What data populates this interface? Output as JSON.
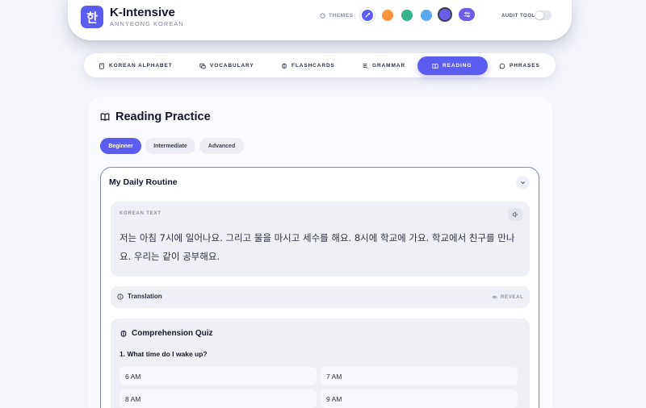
{
  "header": {
    "logo_glyph": "한",
    "title": "K-Intensive",
    "subtitle": "ANNYEONG KOREAN",
    "themes_label": "THEMES",
    "theme_colors": [
      "#5b5cf0",
      "#fb923c",
      "#34b38a",
      "#5aa9f0",
      "#6d5ce6"
    ],
    "audit_label": "AUDIT TOOL"
  },
  "nav": {
    "items": [
      {
        "label": "KOREAN ALPHABET",
        "icon": "book-icon"
      },
      {
        "label": "VOCABULARY",
        "icon": "chat-icon"
      },
      {
        "label": "FLASHCARDS",
        "icon": "brain-icon"
      },
      {
        "label": "GRAMMAR",
        "icon": "notes-icon"
      },
      {
        "label": "READING",
        "icon": "open-book-icon",
        "active": true
      },
      {
        "label": "PHRASES",
        "icon": "bubble-icon"
      }
    ]
  },
  "main": {
    "title": "Reading Practice",
    "levels": [
      "Beginner",
      "Intermediate",
      "Advanced"
    ],
    "story": {
      "title": "My Daily Routine",
      "korean_label": "KOREAN TEXT",
      "korean_text": "저는 아침 7시에 일어나요. 그리고 물을 마시고 세수를 해요. 8시에 학교에 가요. 학교에서 친구를 만나요. 우리는 같이 공부해요.",
      "translation_label": "Translation",
      "reveal_label": "REVEAL",
      "quiz": {
        "title": "Comprehension Quiz",
        "question": "1. What time do I wake up?",
        "options": [
          "6 AM",
          "7 AM",
          "8 AM",
          "9 AM"
        ]
      }
    }
  },
  "colors": {
    "accent": "#5b5cf0"
  }
}
